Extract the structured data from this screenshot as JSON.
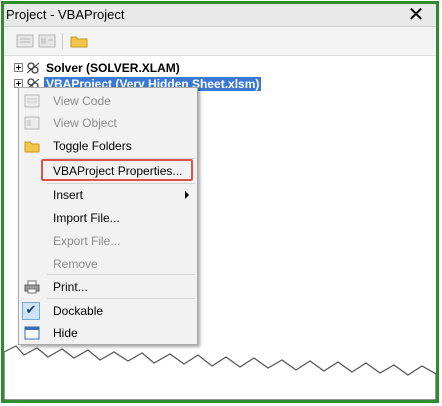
{
  "window": {
    "title": "Project - VBAProject",
    "close_glyph": "✕"
  },
  "toolbar": {
    "buttons": [
      "view-code-icon",
      "view-object-icon",
      "toggle-folders-icon"
    ]
  },
  "tree": {
    "items": [
      {
        "label": "Solver (SOLVER.XLAM)",
        "selected": false
      },
      {
        "label": "VBAProject (Very Hidden Sheet.xlsm)",
        "selected": true
      }
    ]
  },
  "menu": {
    "items": [
      {
        "label": "View Code",
        "enabled": false,
        "icon": "view-code-icon"
      },
      {
        "label": "View Object",
        "enabled": false,
        "icon": "view-object-icon"
      },
      {
        "label": "Toggle Folders",
        "enabled": true,
        "icon": "folder-icon"
      },
      {
        "label": "VBAProject Properties...",
        "enabled": true,
        "highlighted": true
      },
      {
        "label": "Insert",
        "enabled": true,
        "submenu": true
      },
      {
        "label": "Import File...",
        "enabled": true
      },
      {
        "label": "Export File...",
        "enabled": false
      },
      {
        "label": "Remove",
        "enabled": false
      },
      {
        "label": "Print...",
        "enabled": true,
        "icon": "printer-icon"
      },
      {
        "label": "Dockable",
        "enabled": true,
        "checked": true
      },
      {
        "label": "Hide",
        "enabled": true,
        "icon": "window-icon"
      }
    ]
  },
  "colors": {
    "frame": "#2e8b2e",
    "selection": "#3a78d6",
    "callout": "#d9534f"
  }
}
